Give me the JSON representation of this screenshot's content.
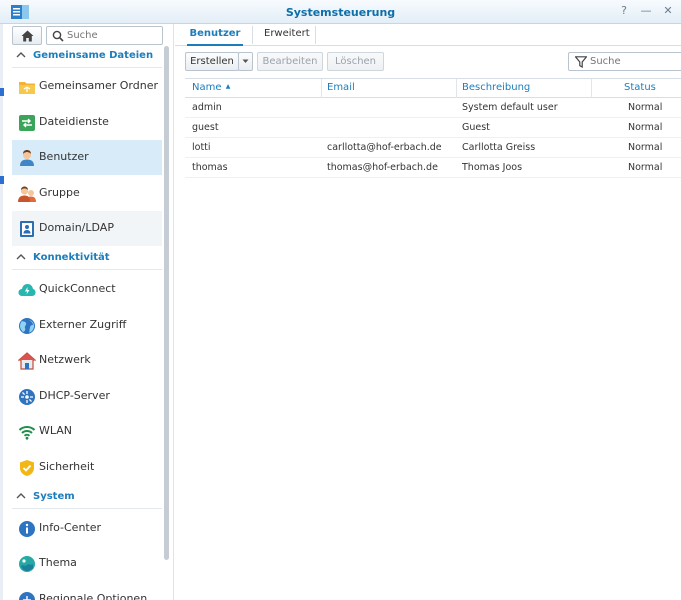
{
  "window": {
    "title": "Systemsteuerung"
  },
  "search": {
    "placeholder": "Suche"
  },
  "sidebar": {
    "sections": [
      {
        "label": "Gemeinsame Dateien",
        "items": [
          "Gemeinsamer Ordner",
          "Dateidienste",
          "Benutzer",
          "Gruppe",
          "Domain/LDAP"
        ]
      },
      {
        "label": "Konnektivität",
        "items": [
          "QuickConnect",
          "Externer Zugriff",
          "Netzwerk",
          "DHCP-Server",
          "WLAN",
          "Sicherheit"
        ]
      },
      {
        "label": "System",
        "items": [
          "Info-Center",
          "Thema",
          "Regionale Optionen"
        ]
      }
    ],
    "selected": "Benutzer"
  },
  "tabs": [
    "Benutzer",
    "Erweitert"
  ],
  "toolbar": {
    "create": "Erstellen",
    "edit": "Bearbeiten",
    "delete": "Löschen",
    "filter_placeholder": "Suche"
  },
  "table": {
    "columns": [
      "Name",
      "Email",
      "Beschreibung",
      "Status"
    ],
    "sort_indicator": "▲",
    "rows": [
      [
        "admin",
        "",
        "System default user",
        "Normal"
      ],
      [
        "guest",
        "",
        "Guest",
        "Normal"
      ],
      [
        "lotti",
        "carllotta@hof-erbach.de",
        "Carllotta Greiss",
        "Normal"
      ],
      [
        "thomas",
        "thomas@hof-erbach.de",
        "Thomas Joos",
        "Normal"
      ]
    ]
  },
  "colors": {
    "accent": "#1d7dbb",
    "selected_bg": "#d8ebf9"
  }
}
